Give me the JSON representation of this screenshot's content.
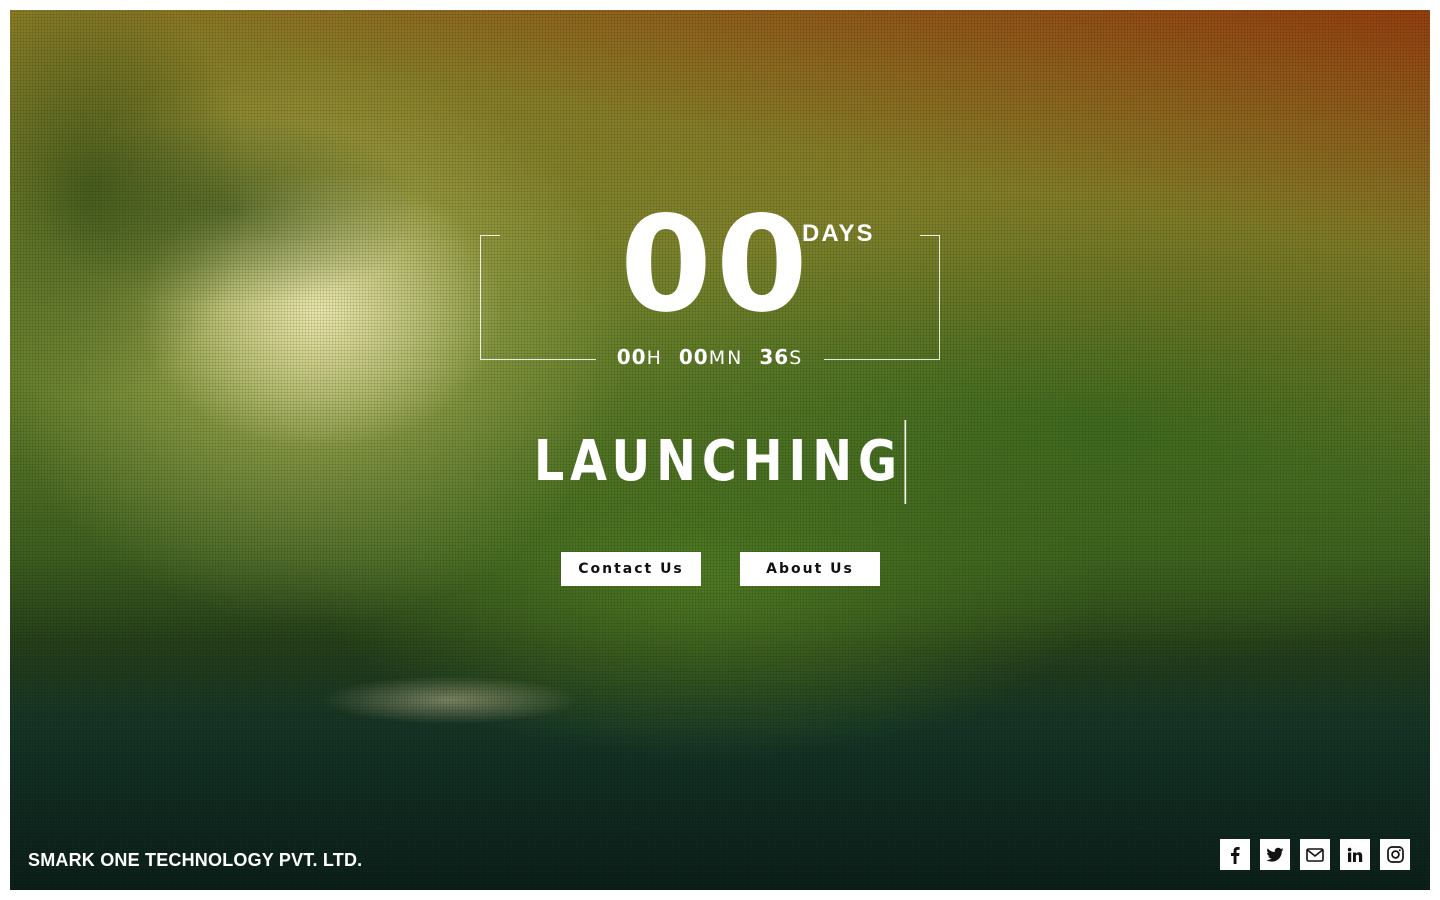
{
  "countdown": {
    "days": "00",
    "days_label": "DAYS",
    "hours": "00",
    "hours_unit": "H",
    "minutes": "00",
    "minutes_unit": "MN",
    "seconds": "36",
    "seconds_unit": "S"
  },
  "headline": "LAUNCHING",
  "buttons": {
    "contact": "Contact Us",
    "about": "About Us"
  },
  "footer": {
    "company": "SMARK ONE TECHNOLOGY PVT. LTD."
  },
  "social": [
    {
      "icon": "facebook-icon"
    },
    {
      "icon": "twitter-icon"
    },
    {
      "icon": "mail-icon"
    },
    {
      "icon": "linkedin-icon"
    },
    {
      "icon": "instagram-icon"
    }
  ],
  "colors": {
    "text": "#ffffff",
    "button_bg": "#ffffff",
    "button_text": "#111111"
  }
}
